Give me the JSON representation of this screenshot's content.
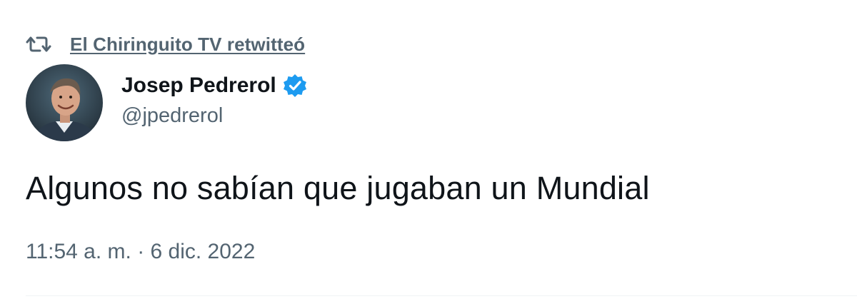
{
  "retweet": {
    "icon": "retweet-icon",
    "label": "El Chiringuito TV retwitteó"
  },
  "author": {
    "avatar_icon": "avatar",
    "name": "Josep Pedrerol",
    "verified_icon": "verified-badge-icon",
    "verified_color": "#1d9bf0",
    "handle": "@jpedrerol"
  },
  "tweet": {
    "text": "Algunos no sabían que jugaban un Mundial",
    "timestamp": "11:54 a. m. · 6 dic. 2022"
  },
  "colors": {
    "text_primary": "#0f1419",
    "text_secondary": "#536471",
    "divider": "#eff3f4"
  }
}
